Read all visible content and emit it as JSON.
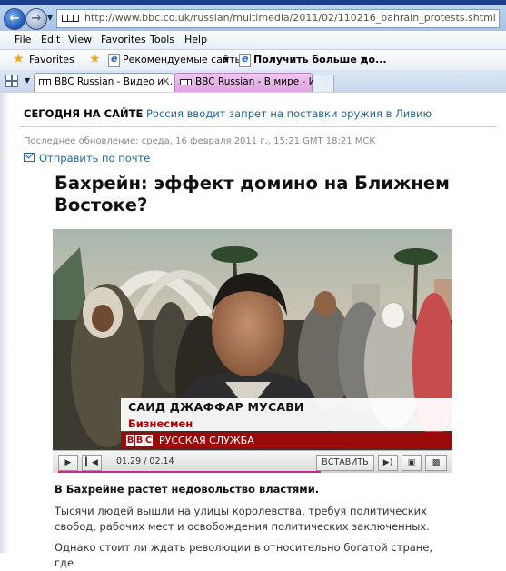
{
  "browser": {
    "url": "http://www.bbc.co.uk/russian/multimedia/2011/02/110216_bahrain_protests.shtml",
    "menu": [
      "File",
      "Edit",
      "View",
      "Favorites",
      "Tools",
      "Help"
    ],
    "favorites_label": "Favorites",
    "recommended_sites": "Рекомендуемые сайты",
    "get_more": "Получить больше до...",
    "tabs": [
      {
        "title": "BBC Russian - Видео и ...",
        "active": true
      },
      {
        "title": "BBC Russian - В мире - И...",
        "active": false
      }
    ]
  },
  "page": {
    "today_label": "СЕГОДНЯ НА САЙТЕ",
    "today_link": "Россия вводит запрет на поставки оружия в Ливию",
    "last_updated": "Последнее обновление: среда, 16 февраля 2011 г., 15:21 GMT 18:21 МСК",
    "email_link": "Отправить по почте",
    "headline": "Бахрейн: эффект домино на Ближнем Востоке?",
    "video": {
      "speaker_name": "САИД ДЖАФФАР МУСАВИ",
      "speaker_role": "Бизнесмен",
      "service": "РУССКАЯ СЛУЖБА",
      "bbc_letters": [
        "B",
        "B",
        "C"
      ],
      "timecode": "01.29 / 02.14",
      "embed_label": "ВСТАВИТЬ",
      "progress_fraction": 0.675
    },
    "lead": "В Бахрейне растет недовольство властями.",
    "paragraph1": "Тысячи людей вышли на улицы королевства, требуя политических свобод, рабочих мест и освобождения политических заключенных.",
    "paragraph2": "Однако стоит ли ждать революции в относительно богатой стране, где"
  },
  "colors": {
    "link": "#1f64a8",
    "bbc_red": "#9b0a0a",
    "progress": "#c42a8a"
  }
}
